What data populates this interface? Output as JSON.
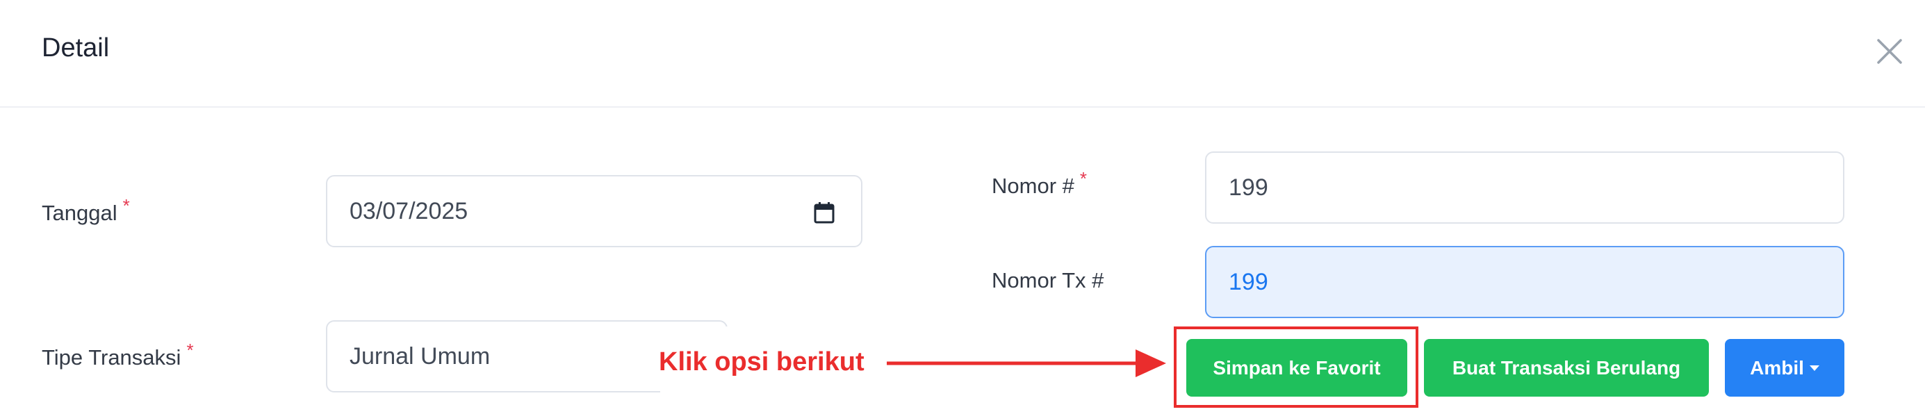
{
  "dialog": {
    "title": "Detail"
  },
  "form": {
    "tanggal": {
      "label": "Tanggal",
      "required_mark": "*",
      "value": "03/07/2025"
    },
    "tipe_transaksi": {
      "label": "Tipe Transaksi",
      "required_mark": "*",
      "value": "Jurnal Umum"
    },
    "nomor": {
      "label": "Nomor #",
      "required_mark": "*",
      "value": "199"
    },
    "nomor_tx": {
      "label": "Nomor Tx #",
      "value": "199"
    }
  },
  "actions": {
    "save_favorite": "Simpan ke Favorit",
    "create_recurring": "Buat Transaksi Berulang",
    "ambil": "Ambil"
  },
  "annotation": {
    "text": "Klik opsi berikut"
  },
  "colors": {
    "accent_green": "#1fc05c",
    "accent_blue": "#2582f5",
    "annotation_red": "#ea2d2d",
    "required_red": "#e53950"
  },
  "icons": {
    "close": "close-icon",
    "calendar": "calendar-icon",
    "dropdown": "chevron-down-icon",
    "arrow": "arrow-right-icon"
  }
}
